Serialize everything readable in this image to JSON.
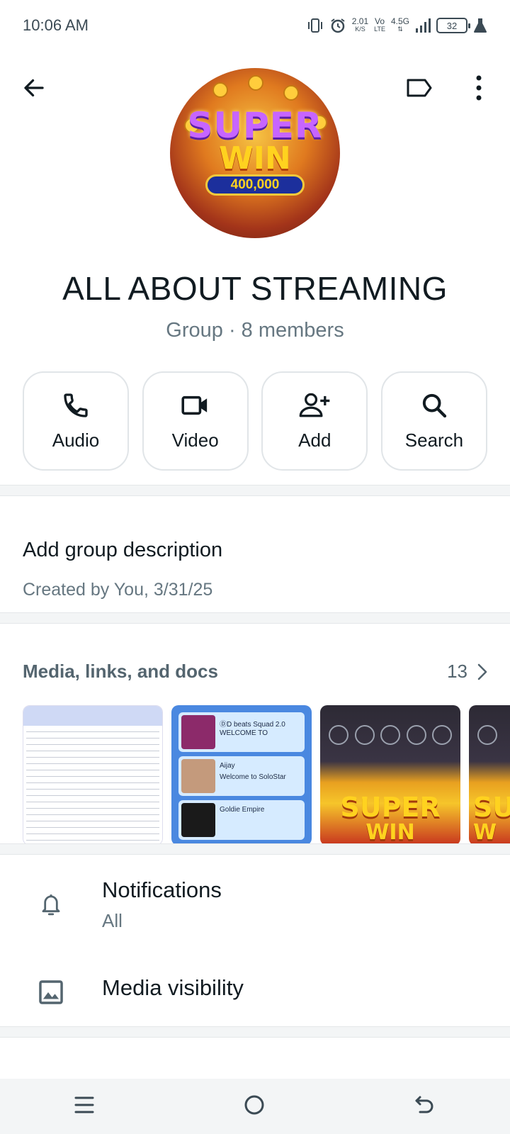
{
  "status_bar": {
    "time": "10:06 AM",
    "net_speed_value": "2.01",
    "net_speed_unit": "K/S",
    "volte_top": "Vo",
    "volte_bottom": "LTE",
    "network_type": "4.5G",
    "battery_level": "32"
  },
  "group": {
    "name": "ALL ABOUT STREAMING",
    "meta": "Group · 8 members",
    "avatar_word_1": "SUPER",
    "avatar_word_2": "WIN",
    "avatar_amount": "400,000"
  },
  "actions": [
    {
      "label": "Audio",
      "icon": "phone-icon"
    },
    {
      "label": "Video",
      "icon": "video-camera-icon"
    },
    {
      "label": "Add",
      "icon": "add-person-icon"
    },
    {
      "label": "Search",
      "icon": "search-icon"
    }
  ],
  "description": {
    "title": "Add group description",
    "created": "Created by You, 3/31/25"
  },
  "media": {
    "title": "Media, links, and docs",
    "count": "13",
    "thumb2_cards": [
      {
        "name": "ⒹD beats Squad 2.0",
        "line": "WELCOME TO"
      },
      {
        "name": "Aijay",
        "line": "Welcome to SoloStar"
      },
      {
        "name": "Goldie Empire",
        "line": ""
      }
    ],
    "thumb3_word_1": "SUPER",
    "thumb3_word_2": "WIN",
    "thumb4_word_1": "SU",
    "thumb4_word_2": "W"
  },
  "settings": {
    "notifications_title": "Notifications",
    "notifications_value": "All",
    "media_visibility_title": "Media visibility"
  },
  "colors": {
    "text_primary": "#111b21",
    "text_secondary": "#667781",
    "divider_bg": "#f3f5f6"
  }
}
